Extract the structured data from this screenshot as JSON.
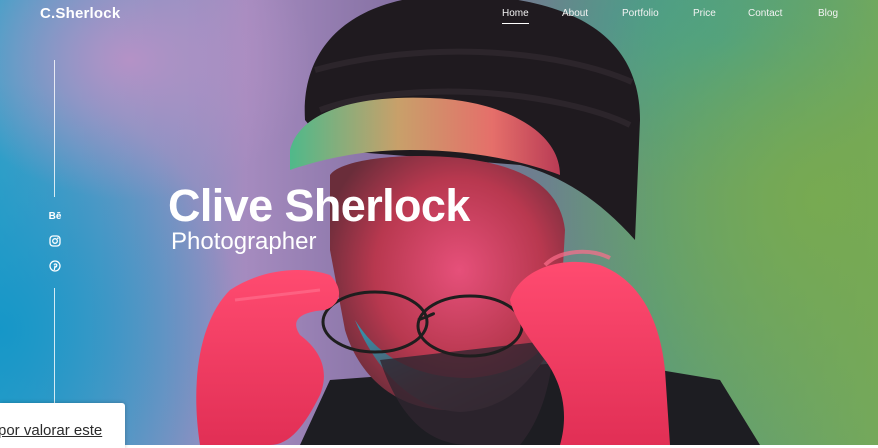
{
  "header": {
    "logo": "C.Sherlock"
  },
  "nav": {
    "items": [
      {
        "label": "Home",
        "active": true
      },
      {
        "label": "About"
      },
      {
        "label": "Portfolio"
      },
      {
        "label": "Price"
      },
      {
        "label": "Contact"
      },
      {
        "label": "Blog"
      }
    ]
  },
  "social": {
    "behance": {
      "icon": "behance-icon",
      "label": "Bē"
    },
    "instagram": {
      "icon": "instagram-icon"
    },
    "pinterest": {
      "icon": "pinterest-icon"
    }
  },
  "hero": {
    "name": "Clive Sherlock",
    "role": "Photographer",
    "photo_icon": "portrait-photo"
  },
  "consent": {
    "link": "por valorar este"
  },
  "colors": {
    "accent": "#ffffff",
    "neon_pink": "#ff3d6e",
    "teal": "#1f9fc4",
    "green": "#78ad5c"
  }
}
